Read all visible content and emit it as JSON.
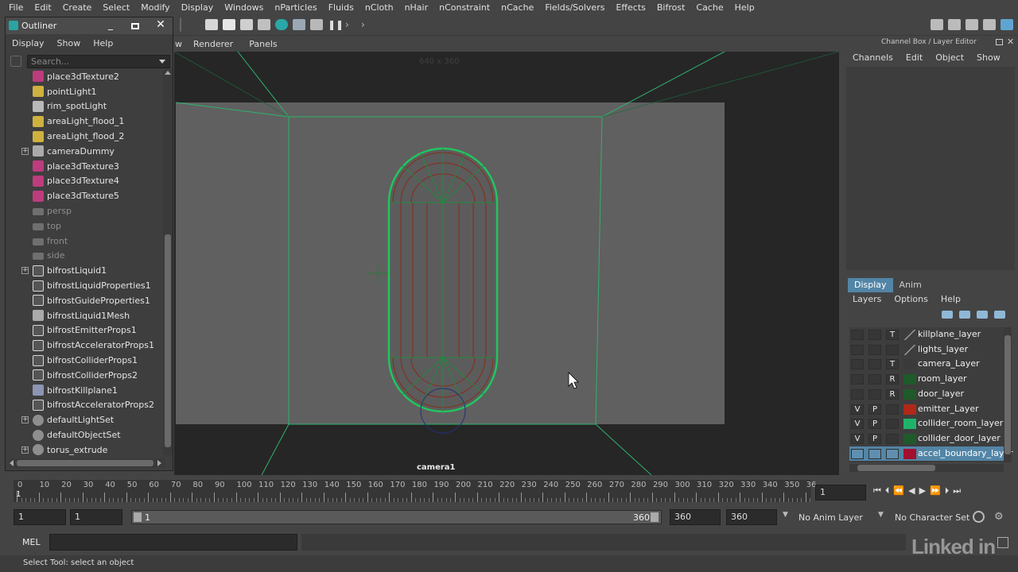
{
  "menubar": [
    "File",
    "Edit",
    "Create",
    "Select",
    "Modify",
    "Display",
    "Windows",
    "nParticles",
    "Fluids",
    "nCloth",
    "nHair",
    "nConstraint",
    "nCache",
    "Fields/Solvers",
    "Effects",
    "Bifrost",
    "Cache",
    "Help"
  ],
  "outliner": {
    "title": "Outliner",
    "menu": [
      "Display",
      "Show",
      "Help"
    ],
    "search_placeholder": "Search...",
    "items": [
      {
        "label": "place3dTexture2",
        "icon": "texture-icon",
        "expand": false,
        "dim": false
      },
      {
        "label": "pointLight1",
        "icon": "point-light-icon",
        "expand": false,
        "dim": false
      },
      {
        "label": "rim_spotLight",
        "icon": "spot-light-icon",
        "expand": false,
        "dim": false
      },
      {
        "label": "areaLight_flood_1",
        "icon": "area-light-icon",
        "expand": false,
        "dim": false
      },
      {
        "label": "areaLight_flood_2",
        "icon": "area-light-icon",
        "expand": false,
        "dim": false
      },
      {
        "label": "cameraDummy",
        "icon": "group-icon",
        "expand": true,
        "dim": false
      },
      {
        "label": "place3dTexture3",
        "icon": "texture-icon",
        "expand": false,
        "dim": false
      },
      {
        "label": "place3dTexture4",
        "icon": "texture-icon",
        "expand": false,
        "dim": false
      },
      {
        "label": "place3dTexture5",
        "icon": "texture-icon",
        "expand": false,
        "dim": false
      },
      {
        "label": "persp",
        "icon": "camera-icon",
        "expand": false,
        "dim": true
      },
      {
        "label": "top",
        "icon": "camera-icon",
        "expand": false,
        "dim": true
      },
      {
        "label": "front",
        "icon": "camera-icon",
        "expand": false,
        "dim": true
      },
      {
        "label": "side",
        "icon": "camera-icon",
        "expand": false,
        "dim": true
      },
      {
        "label": "bifrostLiquid1",
        "icon": "bifrost-icon",
        "expand": true,
        "dim": false
      },
      {
        "label": "bifrostLiquidProperties1",
        "icon": "bifrost-icon",
        "expand": false,
        "dim": false
      },
      {
        "label": "bifrostGuideProperties1",
        "icon": "bifrost-icon",
        "expand": false,
        "dim": false
      },
      {
        "label": "bifrostLiquid1Mesh",
        "icon": "mesh-icon",
        "expand": false,
        "dim": false
      },
      {
        "label": "bifrostEmitterProps1",
        "icon": "bifrost-icon",
        "expand": false,
        "dim": false
      },
      {
        "label": "bifrostAcceleratorProps1",
        "icon": "bifrost-icon",
        "expand": false,
        "dim": false
      },
      {
        "label": "bifrostColliderProps1",
        "icon": "bifrost-icon",
        "expand": false,
        "dim": false
      },
      {
        "label": "bifrostColliderProps2",
        "icon": "bifrost-icon",
        "expand": false,
        "dim": false
      },
      {
        "label": "bifrostKillplane1",
        "icon": "killplane-icon",
        "expand": false,
        "dim": false
      },
      {
        "label": "bifrostAcceleratorProps2",
        "icon": "bifrost-icon",
        "expand": false,
        "dim": false
      },
      {
        "label": "defaultLightSet",
        "icon": "set-icon",
        "expand": true,
        "dim": false
      },
      {
        "label": "defaultObjectSet",
        "icon": "set-icon",
        "expand": false,
        "dim": false
      },
      {
        "label": "torus_extrude",
        "icon": "set-icon",
        "expand": true,
        "dim": false
      }
    ]
  },
  "viewport": {
    "menu": [
      "w",
      "Renderer",
      "Panels"
    ],
    "resolution": "640 x 360",
    "camera": "camera1"
  },
  "channel_box": {
    "title": "Channel Box / Layer Editor",
    "menu": [
      "Channels",
      "Edit",
      "Object",
      "Show"
    ]
  },
  "layer_editor": {
    "tabs": [
      "Display",
      "Anim"
    ],
    "menu": [
      "Layers",
      "Options",
      "Help"
    ],
    "layers": [
      {
        "v": "",
        "p": "",
        "t": "T",
        "color": "",
        "name": "killplane_layer",
        "selected": false
      },
      {
        "v": "",
        "p": "",
        "t": "",
        "color": "",
        "name": "lights_layer",
        "selected": false
      },
      {
        "v": "",
        "p": "",
        "t": "T",
        "color": "",
        "name": "camera_Layer",
        "selected": false
      },
      {
        "v": "",
        "p": "",
        "t": "R",
        "color": "#1e5a2a",
        "name": "room_layer",
        "selected": false
      },
      {
        "v": "",
        "p": "",
        "t": "R",
        "color": "#1e5a2a",
        "name": "door_layer",
        "selected": false
      },
      {
        "v": "V",
        "p": "P",
        "t": "",
        "color": "#b22818",
        "name": "emitter_Layer",
        "selected": false
      },
      {
        "v": "V",
        "p": "P",
        "t": "",
        "color": "#1fb36a",
        "name": "collider_room_layer",
        "selected": false
      },
      {
        "v": "V",
        "p": "P",
        "t": "",
        "color": "#1e5a2a",
        "name": "collider_door_layer",
        "selected": false
      },
      {
        "v": "",
        "p": "",
        "t": "",
        "color": "#a3102e",
        "name": "accel_boundary_layer",
        "selected": true
      }
    ]
  },
  "timeline": {
    "ticks": [
      "0",
      "10",
      "20",
      "30",
      "40",
      "50",
      "60",
      "70",
      "80",
      "90",
      "100",
      "110",
      "120",
      "130",
      "140",
      "150",
      "160",
      "170",
      "180",
      "190",
      "200",
      "210",
      "220",
      "230",
      "240",
      "250",
      "260",
      "270",
      "280",
      "290",
      "300",
      "310",
      "320",
      "330",
      "340",
      "350",
      "36"
    ],
    "current_marker": "1",
    "current_frame": "1"
  },
  "range": {
    "start": "1",
    "playback_start": "1",
    "slider_start": "1",
    "slider_end": "360",
    "playback_end": "360",
    "end": "360",
    "anim_layer": "No Anim Layer",
    "character_set": "No Character Set"
  },
  "command": {
    "label": "MEL"
  },
  "status": {
    "text": "Select Tool: select an object"
  },
  "watermark": "Linked in"
}
